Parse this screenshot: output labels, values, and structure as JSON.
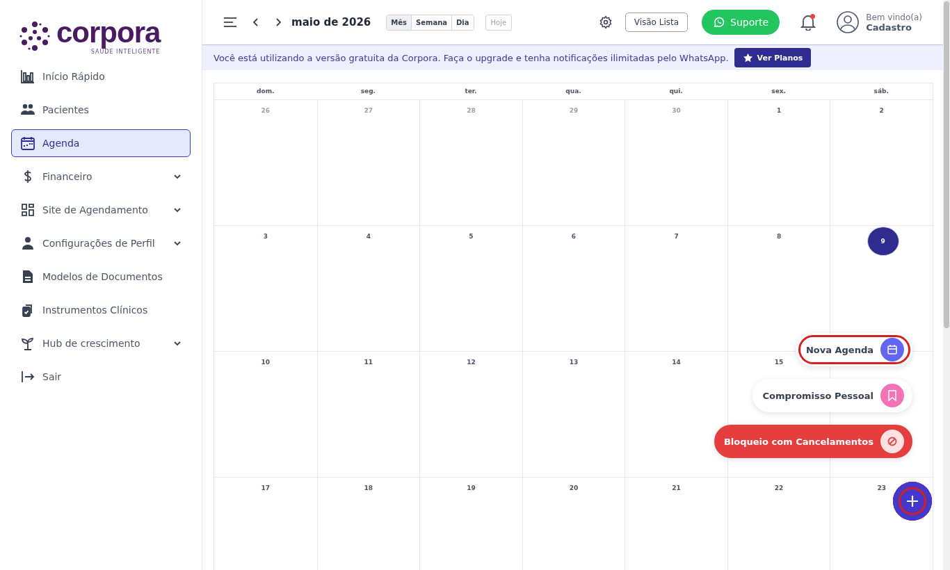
{
  "logo": {
    "name": "corpora",
    "tagline": "SAÚDE INTELIGENTE"
  },
  "sidebar": {
    "items": [
      {
        "label": "Início Rápido",
        "kind": "chart",
        "selected": false,
        "expandable": false
      },
      {
        "label": "Pacientes",
        "kind": "people",
        "selected": false,
        "expandable": false
      },
      {
        "label": "Agenda",
        "kind": "calendar",
        "selected": true,
        "expandable": false
      },
      {
        "label": "Financeiro",
        "kind": "dollar",
        "selected": false,
        "expandable": true
      },
      {
        "label": "Site de Agendamento",
        "kind": "grid",
        "selected": false,
        "expandable": true
      },
      {
        "label": "Configurações de Perfil",
        "kind": "person",
        "selected": false,
        "expandable": true
      },
      {
        "label": "Modelos de Documentos",
        "kind": "document",
        "selected": false,
        "expandable": false
      },
      {
        "label": "Instrumentos Clínicos",
        "kind": "clipboard",
        "selected": false,
        "expandable": false
      },
      {
        "label": "Hub de crescimento",
        "kind": "sprout",
        "selected": false,
        "expandable": true
      },
      {
        "label": "Sair",
        "kind": "exit",
        "selected": false,
        "expandable": false
      }
    ]
  },
  "header": {
    "title": "maio de 2026",
    "views": [
      {
        "label": "Mês",
        "selected": true
      },
      {
        "label": "Semana",
        "selected": false
      },
      {
        "label": "Dia",
        "selected": false
      }
    ],
    "today_button": "Hoje",
    "list_button": "Visão Lista",
    "support_button": "Suporte",
    "notification_unread": true,
    "user": {
      "greeting": "Bem vindo(a)",
      "name": "Cadastro"
    }
  },
  "banner": {
    "text": "Você está utilizando a versão gratuita da Corpora. Faça o upgrade e tenha notificações ilimitadas pelo WhatsApp.",
    "button": "Ver Planos"
  },
  "calendar": {
    "weekdays": [
      "dom.",
      "seg.",
      "ter.",
      "qua.",
      "qui.",
      "sex.",
      "sáb."
    ],
    "weeks": [
      [
        {
          "day": "26",
          "muted": true,
          "today": false
        },
        {
          "day": "27",
          "muted": true,
          "today": false
        },
        {
          "day": "28",
          "muted": true,
          "today": false
        },
        {
          "day": "29",
          "muted": true,
          "today": false
        },
        {
          "day": "30",
          "muted": true,
          "today": false
        },
        {
          "day": "1",
          "muted": false,
          "today": false
        },
        {
          "day": "2",
          "muted": false,
          "today": false
        }
      ],
      [
        {
          "day": "3",
          "muted": false,
          "today": false
        },
        {
          "day": "4",
          "muted": false,
          "today": false
        },
        {
          "day": "5",
          "muted": false,
          "today": false
        },
        {
          "day": "6",
          "muted": false,
          "today": false
        },
        {
          "day": "7",
          "muted": false,
          "today": false
        },
        {
          "day": "8",
          "muted": false,
          "today": false
        },
        {
          "day": "9",
          "muted": false,
          "today": true
        }
      ],
      [
        {
          "day": "10",
          "muted": false,
          "today": false
        },
        {
          "day": "11",
          "muted": false,
          "today": false
        },
        {
          "day": "12",
          "muted": false,
          "today": false
        },
        {
          "day": "13",
          "muted": false,
          "today": false
        },
        {
          "day": "14",
          "muted": false,
          "today": false
        },
        {
          "day": "15",
          "muted": false,
          "today": false
        }
      ],
      [
        {
          "day": "17",
          "muted": false,
          "today": false
        },
        {
          "day": "18",
          "muted": false,
          "today": false
        },
        {
          "day": "19",
          "muted": false,
          "today": false
        },
        {
          "day": "20",
          "muted": false,
          "today": false
        },
        {
          "day": "21",
          "muted": false,
          "today": false
        },
        {
          "day": "22",
          "muted": false,
          "today": false
        },
        {
          "day": "23",
          "muted": false,
          "today": false
        }
      ]
    ]
  },
  "fab_menu": {
    "actions": [
      {
        "label": "Nova Agenda",
        "kind": "calendar",
        "color": "#6366f1",
        "highlighted": true
      },
      {
        "label": "Compromisso Pessoal",
        "kind": "bookmark",
        "color": "#f472b6",
        "highlighted": false
      },
      {
        "label": "Bloqueio com Cancelamentos",
        "kind": "block",
        "color": "#e53e3e",
        "highlighted": false
      }
    ],
    "fab_highlighted": true
  }
}
